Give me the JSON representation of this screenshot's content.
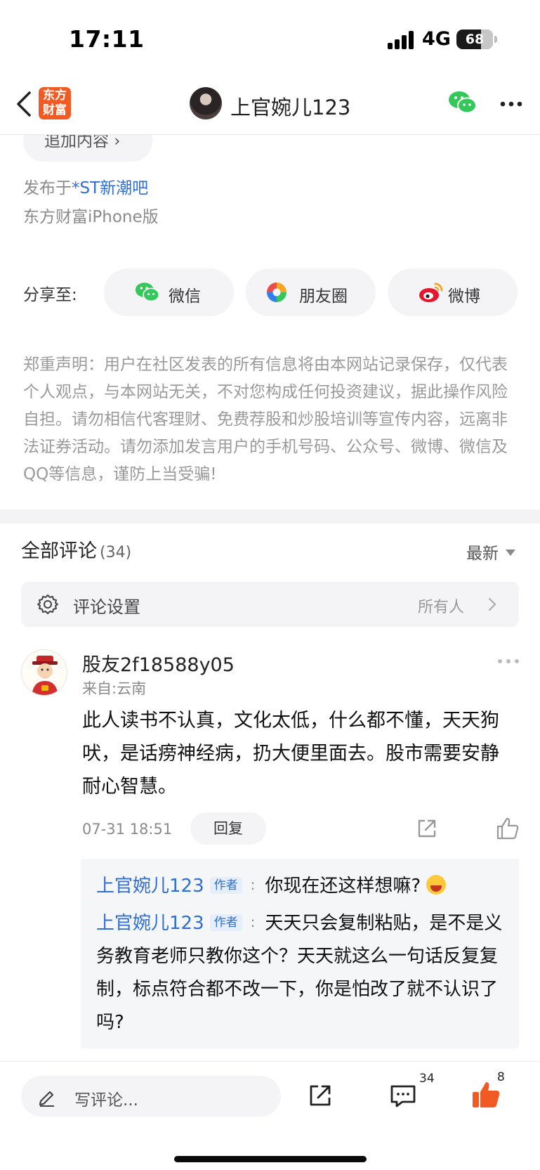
{
  "status_bar": {
    "time": "17:11",
    "network": "4G",
    "battery": "68",
    "battery_level": 0.68
  },
  "header": {
    "logo_line1": "东方",
    "logo_line2": "财富",
    "title": "上官婉儿123",
    "icons": [
      "back-icon",
      "wechat-icon",
      "more-icon"
    ],
    "logo_color": "#f25a23"
  },
  "post": {
    "append_button": "追加内容 ›",
    "published_prefix": "发布于",
    "forum_link": "*ST新潮吧",
    "client": "东方财富iPhone版"
  },
  "share": {
    "label": "分享至:",
    "options": [
      "微信",
      "朋友圈",
      "微博"
    ]
  },
  "disclaimer": "郑重声明：用户在社区发表的所有信息将由本网站记录保存，仅代表个人观点，与本网站无关，不对您构成任何投资建议，据此操作风险自担。请勿相信代客理财、免费荐股和炒股培训等宣传内容，远离非法证券活动。请勿添加发言用户的手机号码、公众号、微博、微信及QQ等信息，谨防上当受骗!",
  "comments": {
    "heading": "全部评论",
    "count": "(34)",
    "sort": "最新",
    "settings_label": "评论设置",
    "settings_value": "所有人",
    "items": [
      {
        "user": "股友2f18588y05",
        "from": "来自:云南",
        "text": "此人读书不认真，文化太低，什么都不懂，天天狗吠，是话痨神经病，扔大便里面去。股市需要安静耐心智慧。",
        "time": "07-31 18:51",
        "reply_button": "回复",
        "replies": [
          {
            "author": "上官婉儿123",
            "tag": "作者",
            "colon": ":",
            "text": "你现在还这样想嘛?"
          },
          {
            "author": "上官婉儿123",
            "tag": "作者",
            "colon": ":",
            "text": "天天只会复制粘贴，是不是义务教育老师只教你这个？天天就这么一句话反复复制，标点符合都不改一下，你是怕改了就不认识了吗?"
          }
        ]
      }
    ]
  },
  "bottom_bar": {
    "input_placeholder": "写评论...",
    "comment_count": "34",
    "like_count": "8",
    "like_color": "#f25a23"
  }
}
